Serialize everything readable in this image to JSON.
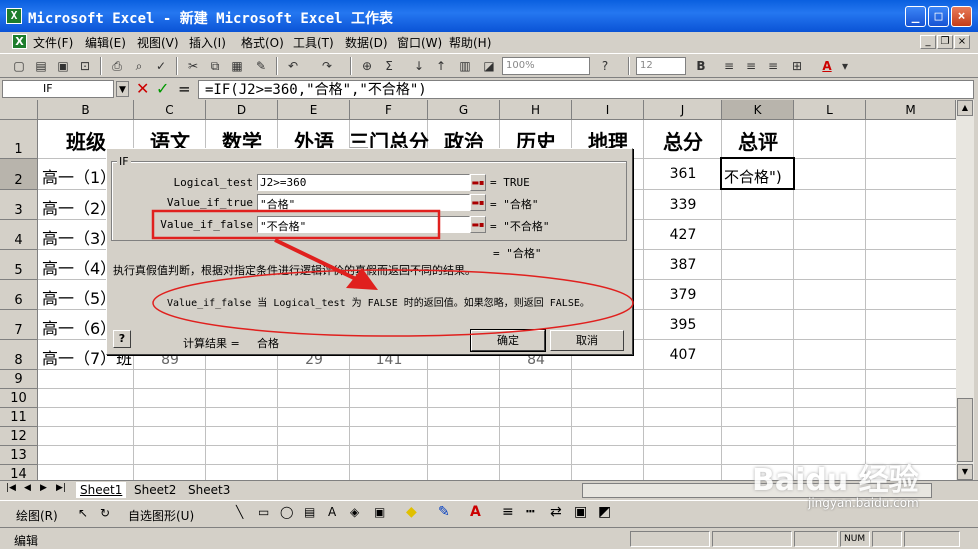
{
  "window": {
    "title": "Microsoft Excel - 新建 Microsoft Excel 工作表",
    "min_label": "_",
    "max_label": "□",
    "close_label": "×"
  },
  "menu": [
    "文件(F)",
    "编辑(E)",
    "视图(V)",
    "插入(I)",
    "格式(O)",
    "工具(T)",
    "数据(D)",
    "窗口(W)",
    "帮助(H)"
  ],
  "toolbar": {
    "zoom": "100%",
    "font_size": "12",
    "bold_label": "B",
    "font_color_label": "A"
  },
  "formula_bar": {
    "name_box": "IF",
    "formula": "=IF(J2>=360,\"合格\",\"不合格\")"
  },
  "columns": [
    "B",
    "C",
    "D",
    "E",
    "F",
    "G",
    "H",
    "I",
    "J",
    "K",
    "L",
    "M"
  ],
  "rows": [
    "1",
    "2",
    "3",
    "4",
    "5",
    "6",
    "7",
    "8",
    "9",
    "10",
    "11",
    "12",
    "13",
    "14"
  ],
  "header_row": [
    "班级",
    "语文",
    "数学",
    "外语",
    "三门总分",
    "政治",
    "历史",
    "地理",
    "总分",
    "总评"
  ],
  "class_cells": [
    "高一（1）",
    "高一（2）",
    "高一（3）",
    "高一（4）",
    "高一（5）",
    "高一（6）",
    "高一（7）班"
  ],
  "totals": [
    "361",
    "339",
    "427",
    "387",
    "379",
    "395",
    "407"
  ],
  "row8_partial": [
    "89",
    "29",
    "141",
    "84"
  ],
  "active_cell_text": "不合格\")",
  "dialog": {
    "group_title": "IF",
    "args": [
      {
        "label": "Logical_test",
        "value": "J2>=360",
        "result": "= TRUE"
      },
      {
        "label": "Value_if_true",
        "value": "\"合格\"",
        "result": "= \"合格\""
      },
      {
        "label": "Value_if_false",
        "value": "\"不合格\"",
        "result": "= \"不合格\""
      }
    ],
    "overall_result": "= \"合格\"",
    "description": "执行真假值判断，根据对指定条件进行逻辑评价的真假而返回不同的结果。",
    "arg_help": "Value_if_false 当 Logical_test 为 FALSE 时的返回值。如果忽略，则返回 FALSE。",
    "calc_label": "计算结果 =",
    "calc_value": "合格",
    "ok": "确定",
    "cancel": "取消",
    "help_icon": "?"
  },
  "sheets": [
    "Sheet1",
    "Sheet2",
    "Sheet3"
  ],
  "drawbar": {
    "draw_label": "绘图(R)",
    "autoshape_label": "自选图形(U)"
  },
  "status": {
    "mode": "编辑",
    "num": "NUM"
  },
  "watermark": {
    "brand": "Baidu 经验",
    "url": "jingyan.baidu.com"
  },
  "colors": {
    "annotation_red": "#e0201e",
    "title_blue": "#0a5fdf"
  }
}
